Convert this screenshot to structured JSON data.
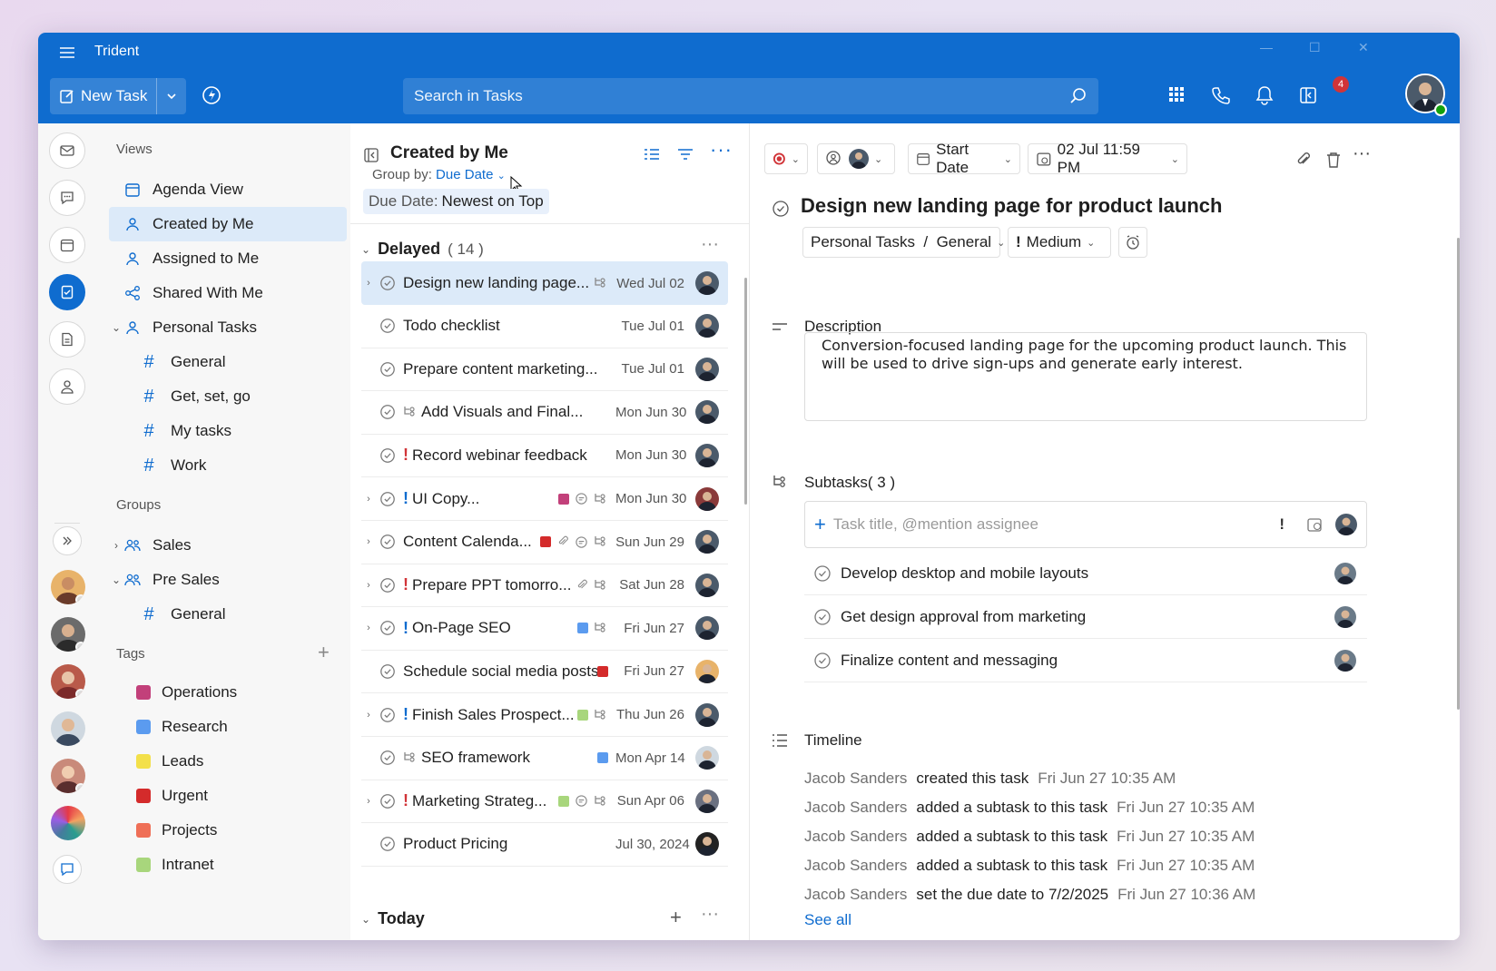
{
  "app": {
    "title": "Trident"
  },
  "toolbar": {
    "new_task": "New Task",
    "search_placeholder": "Search in Tasks",
    "notification_count": "4"
  },
  "nav": {
    "views_label": "Views",
    "views": [
      {
        "label": "Agenda View",
        "icon": "calendar-icon"
      },
      {
        "label": "Created by Me",
        "icon": "person-icon",
        "selected": true
      },
      {
        "label": "Assigned to Me",
        "icon": "person-icon"
      },
      {
        "label": "Shared With Me",
        "icon": "share-icon"
      },
      {
        "label": "Personal Tasks",
        "icon": "person-icon"
      }
    ],
    "personal_children": [
      "General",
      "Get, set, go",
      "My tasks",
      "Work"
    ],
    "groups_label": "Groups",
    "groups": [
      "Sales",
      "Pre Sales"
    ],
    "presales_children": [
      "General"
    ],
    "tags_label": "Tags",
    "tags": [
      {
        "label": "Operations",
        "color": "#c2407a"
      },
      {
        "label": "Research",
        "color": "#5b9bef"
      },
      {
        "label": "Leads",
        "color": "#f3e04a"
      },
      {
        "label": "Urgent",
        "color": "#d42b2b"
      },
      {
        "label": "Projects",
        "color": "#ef6f57"
      },
      {
        "label": "Intranet",
        "color": "#a8d67c"
      }
    ]
  },
  "list": {
    "title": "Created by Me",
    "group_by_label": "Group by:",
    "group_by_value": "Due Date",
    "sort_label": "Due Date:",
    "sort_value": "Newest on Top",
    "group_delayed": "Delayed",
    "group_delayed_count": "( 14 )",
    "group_today": "Today",
    "tasks": [
      {
        "title": "Design new landing page...",
        "date": "Wed Jul 02",
        "expand": true,
        "subtask": true
      },
      {
        "title": "Todo checklist",
        "date": "Tue Jul 01"
      },
      {
        "title": "Prepare content marketing...",
        "date": "Tue Jul 01"
      },
      {
        "title": "Add Visuals and Final...",
        "date": "Mon Jun 30",
        "lead_subtask": true
      },
      {
        "title": "Record webinar feedback",
        "date": "Mon Jun 30",
        "importance": "red"
      },
      {
        "title": "UI Copy...",
        "date": "Mon Jun 30",
        "expand": true,
        "importance": "blue",
        "tag": "#c2407a",
        "comment": true,
        "subtask": true
      },
      {
        "title": "Content Calenda...",
        "date": "Sun Jun 29",
        "expand": true,
        "tag": "#d42b2b",
        "attach": true,
        "comment": true,
        "subtask": true
      },
      {
        "title": "Prepare PPT tomorro...",
        "date": "Sat Jun 28",
        "expand": true,
        "importance": "red",
        "attach": true,
        "subtask": true
      },
      {
        "title": "On-Page SEO",
        "date": "Fri Jun 27",
        "expand": true,
        "importance": "blue",
        "tag": "#5b9bef",
        "subtask": true
      },
      {
        "title": "Schedule social media posts",
        "date": "Fri Jun 27",
        "tag": "#d42b2b"
      },
      {
        "title": "Finish Sales Prospect...",
        "date": "Thu Jun 26",
        "expand": true,
        "importance": "blue",
        "tag": "#a8d67c",
        "subtask": true
      },
      {
        "title": "SEO framework",
        "date": "Mon Apr 14",
        "lead_subtask": true,
        "tag": "#5b9bef"
      },
      {
        "title": "Marketing Strateg...",
        "date": "Sun Apr 06",
        "expand": true,
        "importance": "red",
        "tag": "#a8d67c",
        "comment": true,
        "subtask": true
      },
      {
        "title": "Product Pricing",
        "date": "Jul 30, 2024"
      }
    ]
  },
  "detail": {
    "start_date": "Start Date",
    "due_date": "02 Jul 11:59 PM",
    "title": "Design new landing page for product launch",
    "list_path": "Personal Tasks  /  General",
    "priority": "Medium",
    "description_label": "Description",
    "description": "Conversion-focused landing page for the upcoming product launch. This will be used to drive sign-ups and generate early interest.",
    "subtasks_label": "Subtasks( 3 )",
    "subtask_placeholder": "Task title, @mention assignee",
    "subtasks": [
      "Develop desktop and mobile layouts",
      "Get design approval from marketing",
      "Finalize content and messaging"
    ],
    "timeline_label": "Timeline",
    "timeline": [
      {
        "who": "Jacob Sanders",
        "what": "created this task",
        "when": "Fri Jun 27 10:35 AM"
      },
      {
        "who": "Jacob Sanders",
        "what": "added a subtask to this task",
        "when": "Fri Jun 27 10:35 AM"
      },
      {
        "who": "Jacob Sanders",
        "what": "added a subtask to this task",
        "when": "Fri Jun 27 10:35 AM"
      },
      {
        "who": "Jacob Sanders",
        "what": "added a subtask to this task",
        "when": "Fri Jun 27 10:35 AM"
      },
      {
        "who": "Jacob Sanders",
        "what": "set the due date to 7/2/2025",
        "when": "Fri Jun 27 10:36 AM"
      }
    ],
    "see_all": "See all"
  }
}
